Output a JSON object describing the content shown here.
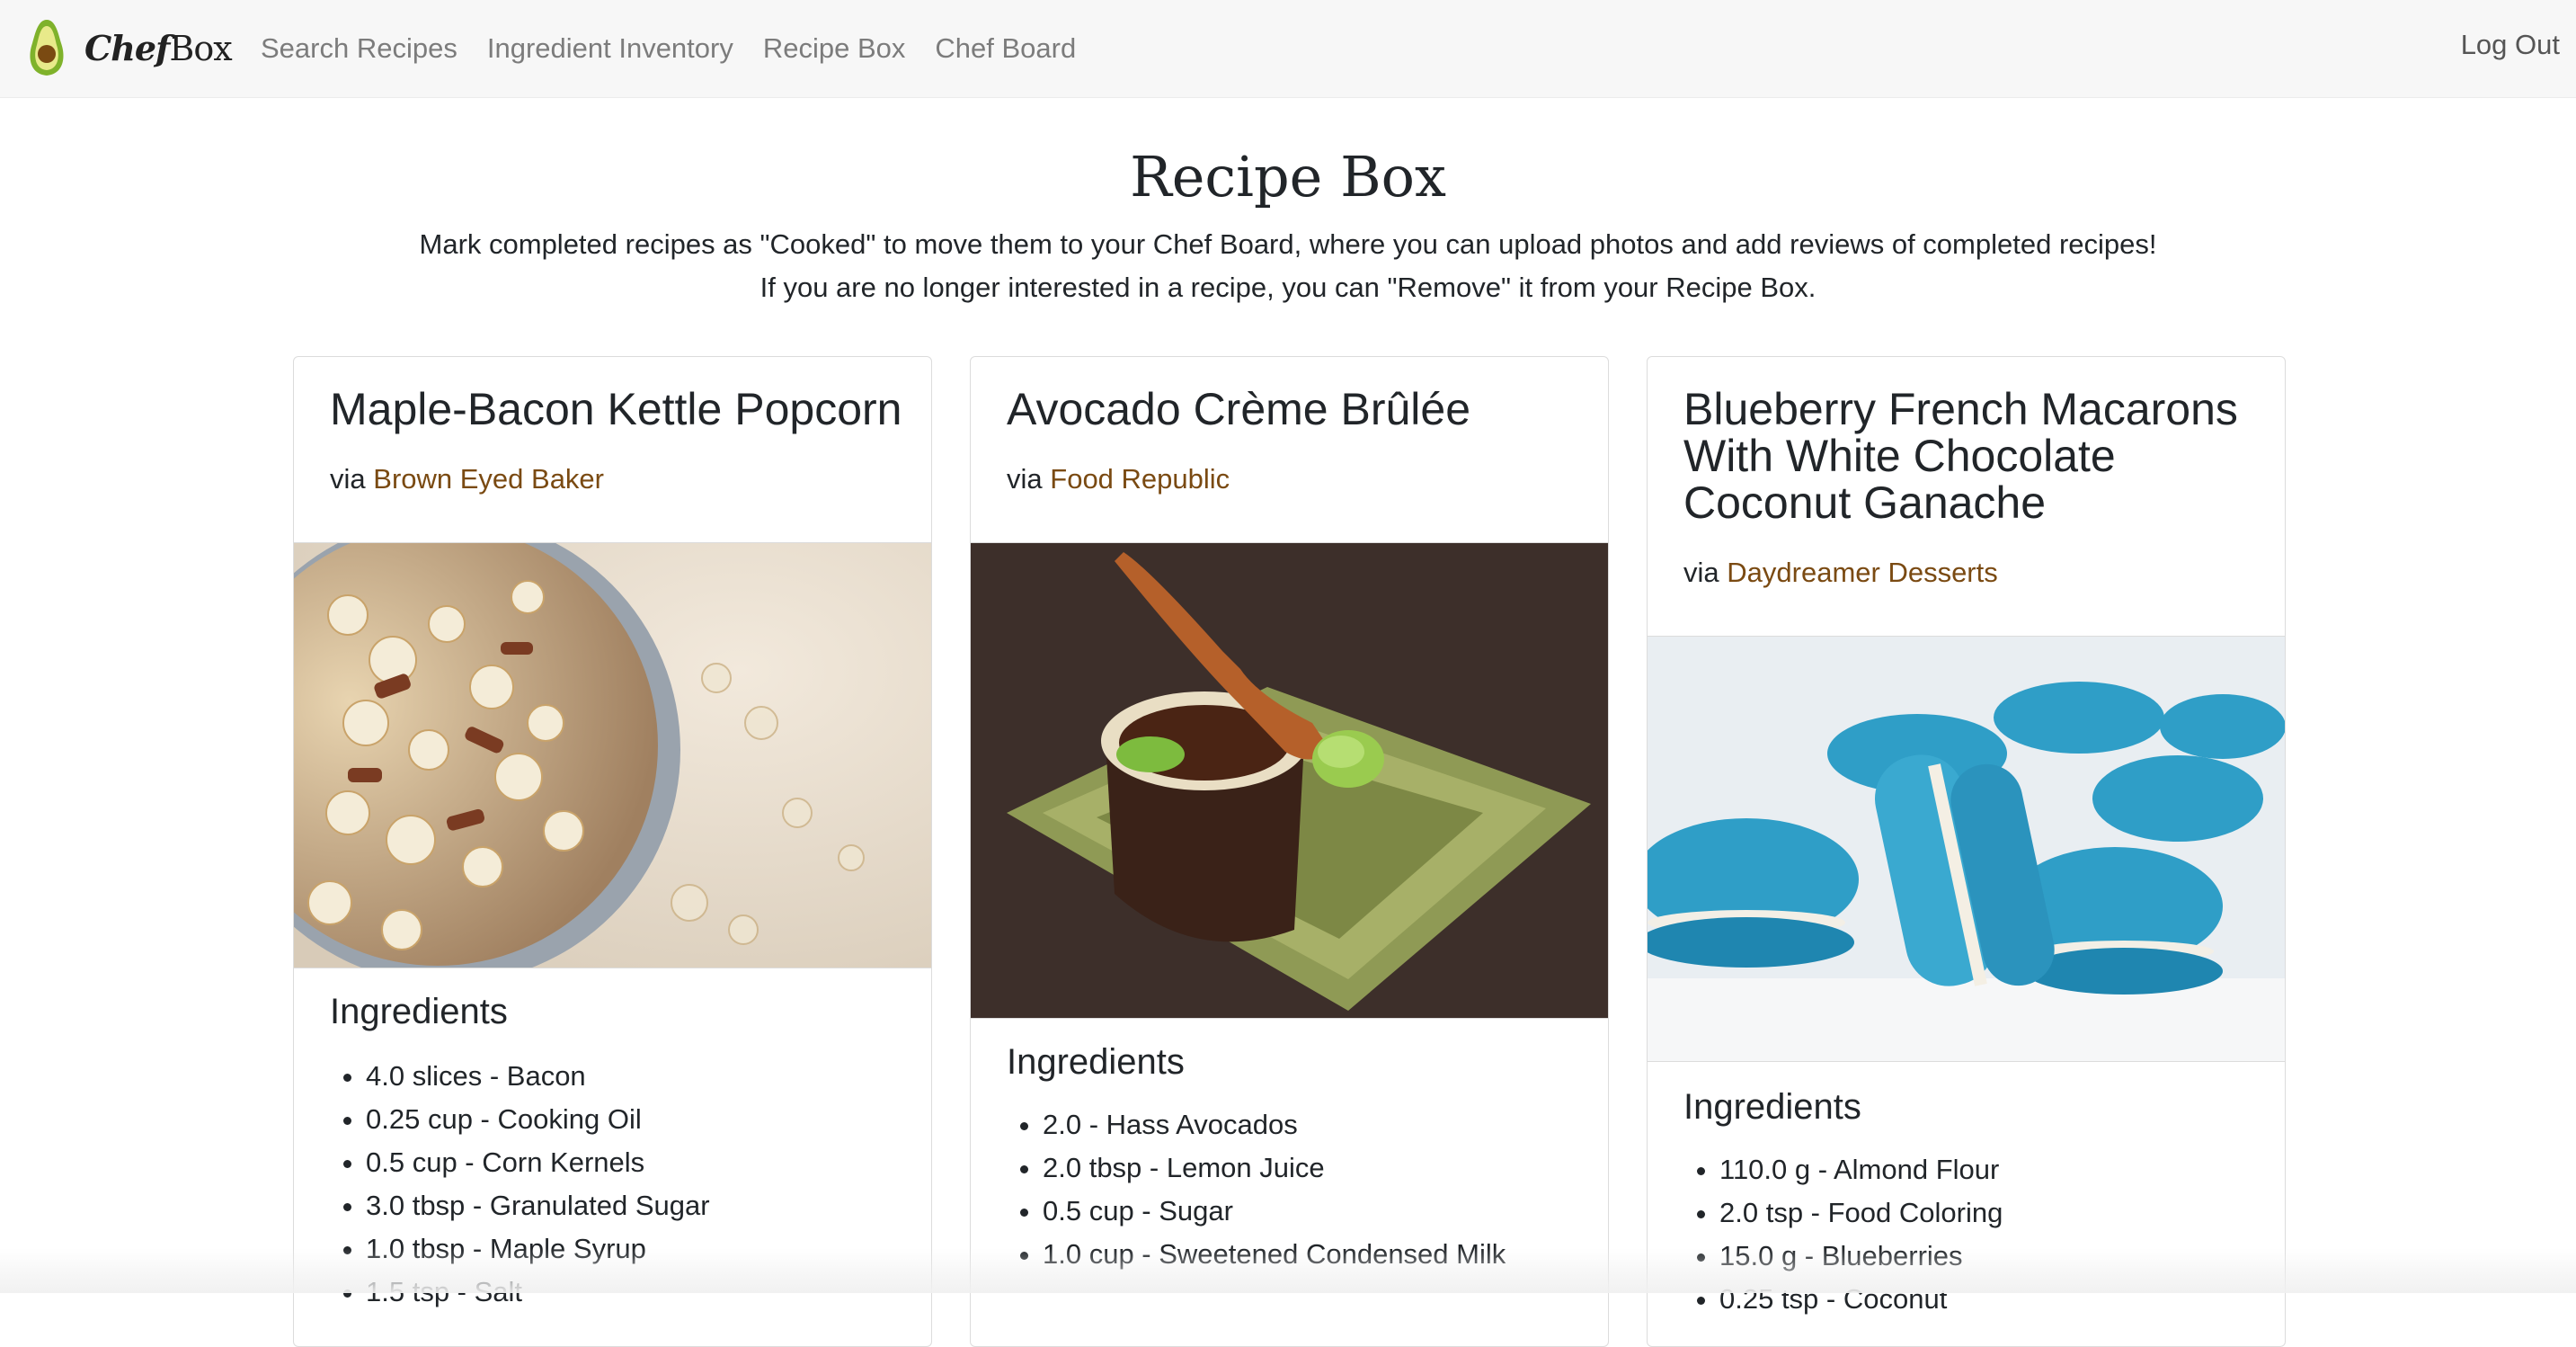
{
  "navbar": {
    "brand": {
      "chef": "Chef",
      "box": "Box"
    },
    "links": [
      "Search Recipes",
      "Ingredient Inventory",
      "Recipe Box",
      "Chef Board"
    ],
    "logout": "Log Out"
  },
  "page": {
    "title": "Recipe Box",
    "intro_line1": "Mark completed recipes as \"Cooked\" to move them to your Chef Board, where you can upload photos and add reviews of completed recipes!",
    "intro_line2": "If you are no longer interested in a recipe, you can \"Remove\" it from your Recipe Box."
  },
  "cards": [
    {
      "title": "Maple-Bacon Kettle Popcorn",
      "via": "via",
      "source": "Brown Eyed Baker",
      "ingredients_heading": "Ingredients",
      "ingredients": [
        "4.0 slices - Bacon",
        "0.25 cup - Cooking Oil",
        "0.5 cup - Corn Kernels",
        "3.0 tbsp - Granulated Sugar",
        "1.0 tbsp - Maple Syrup",
        "1.5 tsp - Salt"
      ]
    },
    {
      "title": "Avocado Crème Brûlée",
      "via": "via",
      "source": "Food Republic",
      "ingredients_heading": "Ingredients",
      "ingredients": [
        "2.0 - Hass Avocados",
        "2.0 tbsp - Lemon Juice",
        "0.5 cup - Sugar",
        "1.0 cup - Sweetened Condensed Milk"
      ]
    },
    {
      "title": "Blueberry French Macarons With White Chocolate Coconut Ganache",
      "via": "via",
      "source": "Daydreamer Desserts",
      "ingredients_heading": "Ingredients",
      "ingredients": [
        "110.0 g - Almond Flour",
        "2.0 tsp - Food Coloring",
        "15.0 g - Blueberries",
        "0.25 tsp - Coconut"
      ]
    }
  ],
  "colors": {
    "navbar_bg": "#f7f7f7",
    "link_text": "#7a4a12",
    "nav_text": "#7c7c7c"
  }
}
